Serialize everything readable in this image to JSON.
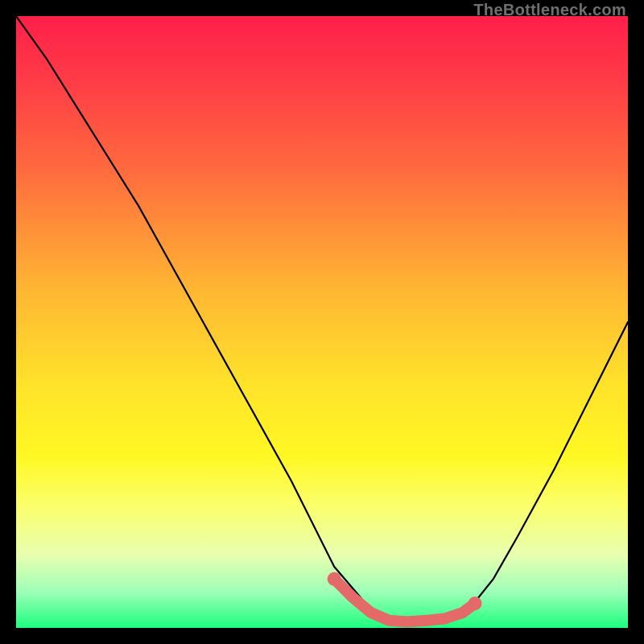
{
  "attribution": "TheBottleneck.com",
  "chart_data": {
    "type": "line",
    "title": "",
    "xlabel": "",
    "ylabel": "",
    "xlim": [
      0,
      100
    ],
    "ylim": [
      0,
      100
    ],
    "series": [
      {
        "name": "bottleneck-curve",
        "x": [
          0,
          5,
          10,
          15,
          20,
          25,
          30,
          35,
          40,
          45,
          50,
          52,
          58,
          60,
          62,
          65,
          70,
          74,
          78,
          82,
          88,
          94,
          100
        ],
        "values": [
          100,
          93,
          85,
          77,
          69,
          60,
          51,
          42,
          33,
          24,
          14,
          10,
          3,
          1,
          1,
          1,
          1,
          3,
          8,
          15,
          26,
          38,
          50
        ]
      }
    ],
    "markers": {
      "name": "highlight-segment",
      "color": "#e46a6a",
      "x": [
        52,
        55,
        58,
        61,
        64,
        67,
        70,
        73,
        75
      ],
      "values": [
        8,
        5,
        2.5,
        1.2,
        1,
        1.2,
        1.5,
        2.5,
        4
      ]
    },
    "gradient_stops": [
      {
        "pct": 0,
        "color": "#ff1f4a"
      },
      {
        "pct": 25,
        "color": "#ff6a3e"
      },
      {
        "pct": 60,
        "color": "#ffe22a"
      },
      {
        "pct": 88,
        "color": "#e8ffb0"
      },
      {
        "pct": 100,
        "color": "#1cff7f"
      }
    ]
  }
}
